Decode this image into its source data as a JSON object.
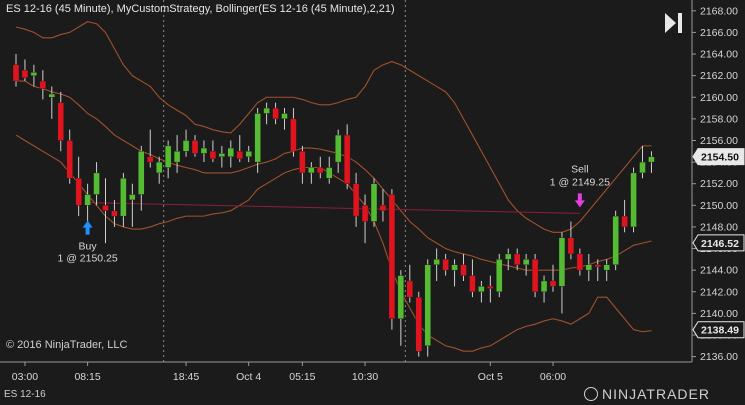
{
  "header": {
    "title": "ES 12-16 (45 Minute), MyCustomStrategy, Bollinger(ES 12-16 (45 Minute),2,21)"
  },
  "footer": {
    "copyright": "© 2016 NinjaTrader, LLC",
    "instrument_tab": "ES 12-16",
    "brand": "NINJATRADER"
  },
  "icons": {
    "play": "play-pause-icon",
    "brand": "ninjatrader-logo-icon"
  },
  "colors": {
    "background": "#1b1b1b",
    "up_candle": "#55bb33",
    "down_candle": "#e0141e",
    "bollinger": "#a0522d",
    "trade_line": "#8b1f3a",
    "buy_arrow": "#1e90ff",
    "sell_arrow": "#e040e0",
    "grid": "#333333"
  },
  "chart_data": {
    "type": "candlestick",
    "y_axis": {
      "min": 2135.5,
      "max": 2169,
      "ticks": [
        2136,
        2138,
        2140,
        2142,
        2144,
        2146,
        2148,
        2150,
        2152,
        2154,
        2156,
        2158,
        2160,
        2162,
        2164,
        2166,
        2168
      ],
      "tick_labels": [
        "2136.00",
        "2138.00",
        "2140.00",
        "2142.00",
        "2144.00",
        "2146.00",
        "2148.00",
        "2150.00",
        "2152.00",
        "2154.00",
        "2156.00",
        "2158.00",
        "2160.00",
        "2162.00",
        "2164.00",
        "2166.00",
        "2168.00"
      ]
    },
    "x_axis": {
      "labels": [
        {
          "text": "03:00",
          "bar": 1
        },
        {
          "text": "08:15",
          "bar": 8
        },
        {
          "text": "18:45",
          "bar": 19
        },
        {
          "text": "Oct 4",
          "bar": 26
        },
        {
          "text": "05:15",
          "bar": 32
        },
        {
          "text": "10:30",
          "bar": 39
        },
        {
          "text": "Oct 5",
          "bar": 53
        },
        {
          "text": "06:00",
          "bar": 60
        }
      ],
      "session_breaks": [
        16,
        43
      ]
    },
    "price_markers": [
      {
        "value": 2154.5,
        "label": "2154.50",
        "style": "filled"
      },
      {
        "value": 2146.52,
        "label": "2146.52",
        "style": "outline"
      },
      {
        "value": 2138.49,
        "label": "2138.49",
        "style": "outline"
      }
    ],
    "candles": [
      [
        2163.0,
        2164.0,
        2161.0,
        2161.5
      ],
      [
        2162.5,
        2163.5,
        2161.5,
        2161.8
      ],
      [
        2162.0,
        2163.0,
        2161.0,
        2162.3
      ],
      [
        2161.5,
        2162.5,
        2159.8,
        2160.8
      ],
      [
        2160.0,
        2161.0,
        2158.0,
        2160.3
      ],
      [
        2159.5,
        2160.5,
        2155.0,
        2156.0
      ],
      [
        2156.0,
        2157.0,
        2152.0,
        2152.5
      ],
      [
        2152.5,
        2154.5,
        2149.0,
        2150.0
      ],
      [
        2150.0,
        2152.0,
        2148.0,
        2151.0
      ],
      [
        2151.0,
        2154.0,
        2150.0,
        2153.0
      ],
      [
        2150.0,
        2152.5,
        2146.5,
        2149.5
      ],
      [
        2149.5,
        2150.5,
        2148.0,
        2149.0
      ],
      [
        2149.0,
        2153.0,
        2148.0,
        2152.5
      ],
      [
        2150.5,
        2152.0,
        2148.0,
        2151.0
      ],
      [
        2151.0,
        2155.5,
        2149.5,
        2155.0
      ],
      [
        2154.5,
        2157.0,
        2153.5,
        2154.0
      ],
      [
        2153.0,
        2154.5,
        2152.0,
        2154.0
      ],
      [
        2153.5,
        2156.0,
        2152.5,
        2155.5
      ],
      [
        2154.0,
        2156.5,
        2153.0,
        2155.0
      ],
      [
        2155.0,
        2157.0,
        2154.5,
        2156.0
      ],
      [
        2156.0,
        2156.5,
        2154.5,
        2154.8
      ],
      [
        2154.8,
        2156.0,
        2154.0,
        2155.3
      ],
      [
        2155.0,
        2156.0,
        2154.0,
        2154.3
      ],
      [
        2154.5,
        2155.5,
        2153.5,
        2154.8
      ],
      [
        2154.5,
        2156.0,
        2153.5,
        2155.3
      ],
      [
        2155.0,
        2156.5,
        2154.0,
        2154.3
      ],
      [
        2154.5,
        2155.5,
        2154.0,
        2155.0
      ],
      [
        2154.0,
        2159.0,
        2153.0,
        2158.5
      ],
      [
        2158.5,
        2159.5,
        2157.5,
        2159.0
      ],
      [
        2159.0,
        2159.5,
        2157.5,
        2158.0
      ],
      [
        2158.0,
        2159.0,
        2157.0,
        2158.5
      ],
      [
        2158.0,
        2159.0,
        2154.5,
        2155.0
      ],
      [
        2155.0,
        2155.5,
        2152.0,
        2153.0
      ],
      [
        2153.0,
        2154.0,
        2152.0,
        2153.5
      ],
      [
        2153.5,
        2154.5,
        2152.5,
        2153.0
      ],
      [
        2152.5,
        2154.5,
        2152.0,
        2153.5
      ],
      [
        2154.0,
        2157.0,
        2153.0,
        2156.5
      ],
      [
        2156.5,
        2157.5,
        2151.5,
        2152.0
      ],
      [
        2152.0,
        2153.0,
        2148.0,
        2149.0
      ],
      [
        2150.0,
        2151.0,
        2146.5,
        2148.5
      ],
      [
        2148.5,
        2152.5,
        2148.0,
        2152.0
      ],
      [
        2150.0,
        2151.5,
        2148.5,
        2149.5
      ],
      [
        2151.0,
        2151.5,
        2138.5,
        2139.5
      ],
      [
        2139.5,
        2144.0,
        2137.0,
        2143.5
      ],
      [
        2143.0,
        2144.5,
        2141.0,
        2141.5
      ],
      [
        2141.5,
        2142.0,
        2136.0,
        2136.5
      ],
      [
        2137.0,
        2145.0,
        2136.0,
        2144.5
      ],
      [
        2144.5,
        2146.0,
        2143.0,
        2145.0
      ],
      [
        2145.0,
        2145.5,
        2143.5,
        2144.0
      ],
      [
        2144.0,
        2145.0,
        2142.5,
        2144.5
      ],
      [
        2144.5,
        2145.5,
        2143.0,
        2143.5
      ],
      [
        2143.5,
        2145.0,
        2141.5,
        2142.0
      ],
      [
        2142.0,
        2143.0,
        2141.0,
        2142.5
      ],
      [
        2142.5,
        2143.5,
        2141.0,
        2142.3
      ],
      [
        2142.0,
        2145.5,
        2141.5,
        2145.0
      ],
      [
        2145.0,
        2146.0,
        2144.0,
        2145.5
      ],
      [
        2145.5,
        2146.0,
        2144.0,
        2144.5
      ],
      [
        2144.5,
        2145.5,
        2143.5,
        2145.0
      ],
      [
        2145.0,
        2145.5,
        2141.5,
        2142.0
      ],
      [
        2142.0,
        2143.5,
        2141.0,
        2143.0
      ],
      [
        2143.0,
        2144.5,
        2142.0,
        2142.5
      ],
      [
        2142.5,
        2147.5,
        2140.0,
        2147.0
      ],
      [
        2147.0,
        2148.5,
        2145.0,
        2145.5
      ],
      [
        2145.5,
        2146.0,
        2143.5,
        2144.0
      ],
      [
        2144.0,
        2145.5,
        2143.0,
        2144.5
      ],
      [
        2144.5,
        2145.0,
        2143.0,
        2144.3
      ],
      [
        2144.0,
        2145.0,
        2143.0,
        2144.5
      ],
      [
        2144.5,
        2149.5,
        2144.0,
        2149.0
      ],
      [
        2149.0,
        2150.5,
        2147.5,
        2148.0
      ],
      [
        2148.0,
        2153.5,
        2147.5,
        2153.0
      ],
      [
        2153.0,
        2155.5,
        2152.5,
        2154.0
      ],
      [
        2154.0,
        2155.0,
        2153.0,
        2154.5
      ]
    ],
    "bollinger": {
      "upper": [
        2166.5,
        2166.3,
        2166.0,
        2165.5,
        2165.5,
        2165.8,
        2166.0,
        2166.5,
        2167.0,
        2166.8,
        2166.0,
        2164.5,
        2163.0,
        2162.0,
        2161.5,
        2161.0,
        2160.0,
        2159.3,
        2158.8,
        2158.3,
        2157.5,
        2157.3,
        2157.0,
        2156.8,
        2156.7,
        2157.5,
        2158.5,
        2159.5,
        2160.0,
        2160.0,
        2160.0,
        2160.0,
        2159.8,
        2159.5,
        2159.3,
        2159.3,
        2159.5,
        2159.8,
        2160.0,
        2161.0,
        2162.5,
        2163.0,
        2163.3,
        2163.0,
        2162.5,
        2162.0,
        2161.5,
        2161.0,
        2160.5,
        2159.5,
        2158.0,
        2156.5,
        2155.0,
        2153.5,
        2152.0,
        2150.5,
        2149.5,
        2148.8,
        2148.3,
        2147.8,
        2147.5,
        2147.5,
        2147.8,
        2148.5,
        2149.5,
        2150.5,
        2151.5,
        2152.5,
        2153.5,
        2154.5,
        2155.5,
        2155.5
      ],
      "middle": [
        2161.5,
        2161.5,
        2161.0,
        2160.8,
        2160.5,
        2160.3,
        2160.0,
        2159.3,
        2158.5,
        2158.0,
        2157.3,
        2156.5,
        2156.0,
        2155.5,
        2155.0,
        2154.7,
        2154.3,
        2154.0,
        2153.7,
        2153.5,
        2153.3,
        2153.0,
        2153.0,
        2153.0,
        2153.0,
        2153.2,
        2153.5,
        2153.8,
        2154.0,
        2154.3,
        2154.8,
        2155.0,
        2155.3,
        2155.3,
        2155.2,
        2155.0,
        2154.8,
        2154.5,
        2154.0,
        2153.3,
        2152.5,
        2151.5,
        2150.5,
        2149.5,
        2148.5,
        2147.8,
        2147.0,
        2146.5,
        2146.0,
        2145.7,
        2145.5,
        2145.3,
        2145.0,
        2144.8,
        2144.6,
        2144.4,
        2144.2,
        2144.0,
        2144.0,
        2144.0,
        2144.0,
        2144.0,
        2144.2,
        2144.3,
        2144.5,
        2144.8,
        2145.0,
        2145.3,
        2145.8,
        2146.3,
        2146.5,
        2146.7
      ],
      "lower": [
        2156.5,
        2156.0,
        2155.5,
        2155.0,
        2154.5,
        2154.0,
        2153.0,
        2152.0,
        2151.0,
        2150.0,
        2149.0,
        2148.3,
        2148.0,
        2147.8,
        2147.8,
        2148.0,
        2148.3,
        2148.5,
        2148.8,
        2149.0,
        2149.0,
        2149.0,
        2149.2,
        2149.3,
        2149.5,
        2150.0,
        2150.5,
        2151.5,
        2152.0,
        2152.5,
        2153.0,
        2153.3,
        2153.5,
        2153.5,
        2153.5,
        2153.0,
        2152.5,
        2152.0,
        2151.0,
        2150.0,
        2148.5,
        2146.5,
        2144.0,
        2142.0,
        2140.5,
        2139.0,
        2138.0,
        2137.5,
        2137.0,
        2136.8,
        2136.5,
        2136.5,
        2136.8,
        2137.0,
        2137.5,
        2138.0,
        2138.5,
        2138.8,
        2139.0,
        2139.3,
        2139.5,
        2139.3,
        2139.0,
        2139.5,
        2140.0,
        2141.5,
        2141.5,
        2140.5,
        2139.5,
        2138.5,
        2138.3,
        2138.4
      ]
    },
    "trades": [
      {
        "type": "buy",
        "bar": 8,
        "price": 2150.25,
        "label_line1": "Buy",
        "label_line2": "1 @ 2150.25"
      },
      {
        "type": "sell",
        "bar": 63,
        "price": 2149.25,
        "label_line1": "Sell",
        "label_line2": "1 @ 2149.25"
      }
    ],
    "trade_line": {
      "from_bar": 8,
      "to_bar": 63,
      "from_price": 2150.25,
      "to_price": 2149.25
    }
  }
}
